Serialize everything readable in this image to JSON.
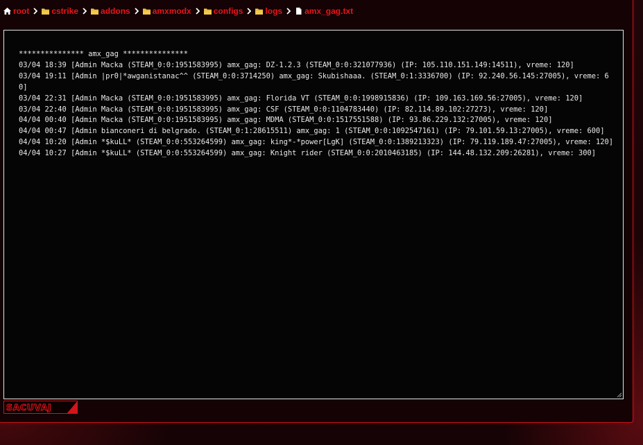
{
  "breadcrumb": {
    "items": [
      {
        "label": "root",
        "icon": "home-icon"
      },
      {
        "label": "cstrike",
        "icon": "folder-icon"
      },
      {
        "label": "addons",
        "icon": "folder-icon"
      },
      {
        "label": "amxmodx",
        "icon": "folder-icon"
      },
      {
        "label": "configs",
        "icon": "folder-icon"
      },
      {
        "label": "logs",
        "icon": "folder-icon"
      },
      {
        "label": "amx_gag.txt",
        "icon": "file-icon"
      }
    ],
    "separator_icon": "chevron-right-icon"
  },
  "editor": {
    "content": "*************** amx_gag ***************\n03/04 18:39 [Admin Macka (STEAM_0:0:1951583995) amx_gag: DZ-1.2.3 (STEAM_0:0:321077936) (IP: 105.110.151.149:14511), vreme: 120]\n03/04 19:11 [Admin |pr0|*awganistanac^^ (STEAM_0:0:3714250) amx_gag: Skubishaaa. (STEAM_0:1:3336700) (IP: 92.240.56.145:27005), vreme: 60]\n03/04 22:31 [Admin Macka (STEAM_0:0:1951583995) amx_gag: Florida VT (STEAM_0:0:1998915836) (IP: 109.163.169.56:27005), vreme: 120]\n03/04 22:40 [Admin Macka (STEAM_0:0:1951583995) amx_gag: CSF (STEAM_0:0:1104783440) (IP: 82.114.89.102:27273), vreme: 120]\n04/04 00:40 [Admin Macka (STEAM_0:0:1951583995) amx_gag: MDMA (STEAM_0:0:1517551588) (IP: 93.86.229.132:27005), vreme: 120]\n04/04 00:47 [Admin bianconeri di belgrado. (STEAM_0:1:28615511) amx_gag: 1 (STEAM_0:0:1092547161) (IP: 79.101.59.13:27005), vreme: 600]\n04/04 10:20 [Admin *$kuLL* (STEAM_0:0:553264599) amx_gag: king*-*power[LgK] (STEAM_0:0:1389213323) (IP: 79.119.189.47:27005), vreme: 120]\n04/04 10:27 [Admin *$kuLL* (STEAM_0:0:553264599) amx_gag: Knight rider (STEAM_0:0:2010463185) (IP: 144.48.132.209:26281), vreme: 300]"
  },
  "save_button": {
    "label": "SACUVAJ"
  },
  "colors": {
    "accent": "#e8141a",
    "border": "#c21418",
    "background": "#140204",
    "editor_background": "#050505",
    "editor_text": "#e9e9e9",
    "folder": "#f2c94c"
  }
}
